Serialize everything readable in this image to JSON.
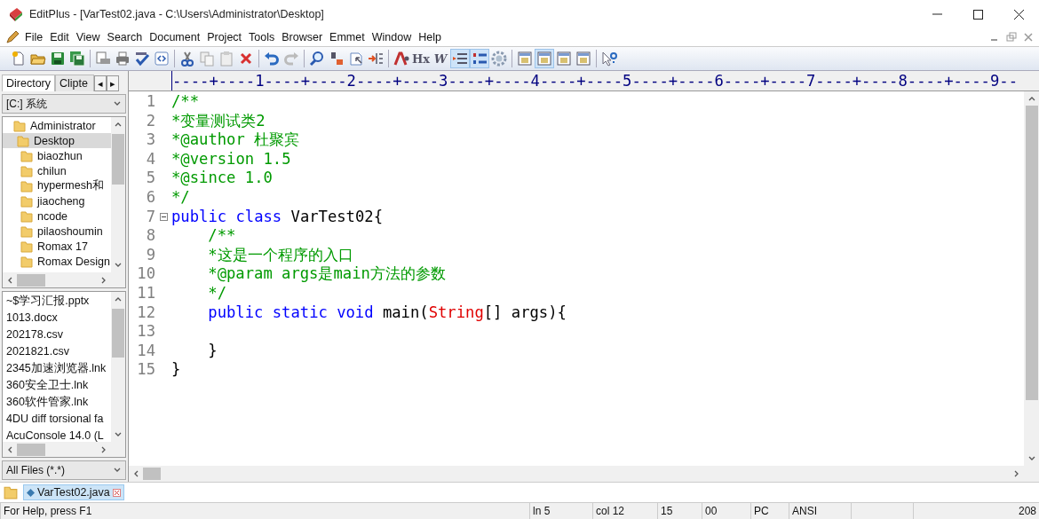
{
  "window": {
    "title": "EditPlus - [VarTest02.java - C:\\Users\\Administrator\\Desktop]"
  },
  "menu": [
    "File",
    "Edit",
    "View",
    "Search",
    "Document",
    "Project",
    "Tools",
    "Browser",
    "Emmet",
    "Window",
    "Help"
  ],
  "toolbar": [
    {
      "kind": "new",
      "on": false
    },
    {
      "kind": "open",
      "on": false
    },
    {
      "kind": "save",
      "on": false
    },
    {
      "kind": "saveall",
      "on": false
    },
    {
      "kind": "sep"
    },
    {
      "kind": "preview",
      "on": false
    },
    {
      "kind": "print",
      "on": false
    },
    {
      "kind": "spell",
      "on": false
    },
    {
      "kind": "browser",
      "on": false
    },
    {
      "kind": "sep"
    },
    {
      "kind": "cut",
      "on": false
    },
    {
      "kind": "copy",
      "on": false
    },
    {
      "kind": "paste",
      "on": false
    },
    {
      "kind": "delete",
      "on": false
    },
    {
      "kind": "sep"
    },
    {
      "kind": "undo",
      "on": false
    },
    {
      "kind": "redo",
      "on": false
    },
    {
      "kind": "sep"
    },
    {
      "kind": "find",
      "on": false
    },
    {
      "kind": "replace",
      "on": false
    },
    {
      "kind": "goto",
      "on": false
    },
    {
      "kind": "insert",
      "on": false
    },
    {
      "kind": "sep"
    },
    {
      "kind": "font",
      "on": false
    },
    {
      "kind": "hex",
      "on": false,
      "glyph": "Hx"
    },
    {
      "kind": "wrap",
      "on": false,
      "glyph": "W"
    },
    {
      "kind": "indent",
      "on": true
    },
    {
      "kind": "linenum",
      "on": true
    },
    {
      "kind": "gear",
      "on": false
    },
    {
      "kind": "sep"
    },
    {
      "kind": "panel",
      "on": false
    },
    {
      "kind": "panel",
      "on": true
    },
    {
      "kind": "panel",
      "on": false
    },
    {
      "kind": "panel",
      "on": false
    },
    {
      "kind": "sep"
    },
    {
      "kind": "help",
      "on": false
    }
  ],
  "sidebar": {
    "tabs": [
      {
        "label": "Directory",
        "selected": true
      },
      {
        "label": "Clipte",
        "selected": false
      }
    ],
    "tab_arrows": [
      "◂",
      "▸"
    ],
    "drive": "[C:] 系统",
    "folders": [
      {
        "label": "Administrator",
        "selected": false,
        "children": [
          {
            "label": "Desktop",
            "selected": true,
            "children": [
              {
                "label": "biaozhun",
                "selected": false
              },
              {
                "label": "chilun",
                "selected": false
              },
              {
                "label": "hypermesh和",
                "selected": false
              },
              {
                "label": "jiaocheng",
                "selected": false
              },
              {
                "label": "ncode",
                "selected": false
              },
              {
                "label": "pilaoshoumin",
                "selected": false
              },
              {
                "label": "Romax 17",
                "selected": false
              },
              {
                "label": "Romax Design",
                "selected": false
              }
            ]
          }
        ]
      }
    ],
    "files": [
      "~$学习汇报.pptx",
      "1013.docx",
      "202178.csv",
      "2021821.csv",
      "2345加速浏览器.lnk",
      "360安全卫士.lnk",
      "360软件管家.lnk",
      "4DU diff torsional fa",
      "AcuConsole 14.0 (L"
    ],
    "filter": "All Files (*.*)"
  },
  "editor": {
    "ruler": "----+----1----+----2----+----3----+----4----+----5----+----6----+----7----+----8----+----9--",
    "lines": [
      {
        "number": "1",
        "tokens": [
          {
            "kind": "comment",
            "text": "/**"
          }
        ]
      },
      {
        "number": "2",
        "tokens": [
          {
            "kind": "comment",
            "text": "*变量测试类2"
          }
        ]
      },
      {
        "number": "3",
        "tokens": [
          {
            "kind": "comment",
            "text": "*@author 杜聚宾"
          }
        ]
      },
      {
        "number": "4",
        "tokens": [
          {
            "kind": "comment",
            "text": "*@version 1.5"
          }
        ]
      },
      {
        "number": "5",
        "tokens": [
          {
            "kind": "comment",
            "text": "*@since 1.0"
          }
        ]
      },
      {
        "number": "6",
        "tokens": [
          {
            "kind": "comment",
            "text": "*/"
          }
        ]
      },
      {
        "number": "7",
        "fold": true,
        "tokens": [
          {
            "kind": "keyword",
            "text": "public "
          },
          {
            "kind": "keyword",
            "text": "class "
          },
          {
            "kind": "plain",
            "text": "VarTest02{"
          }
        ],
        "children": [
          {
            "number": "8",
            "tokens": [
              {
                "kind": "comment",
                "text": "/**"
              }
            ]
          },
          {
            "number": "9",
            "tokens": [
              {
                "kind": "comment",
                "text": "*这是一个程序的入口"
              }
            ]
          },
          {
            "number": "10",
            "tokens": [
              {
                "kind": "comment",
                "text": "*@param args是main方法的参数"
              }
            ]
          },
          {
            "number": "11",
            "tokens": [
              {
                "kind": "comment",
                "text": "*/"
              }
            ]
          },
          {
            "number": "12",
            "tokens": [
              {
                "kind": "keyword",
                "text": "public "
              },
              {
                "kind": "keyword",
                "text": "static "
              },
              {
                "kind": "keyword",
                "text": "void "
              },
              {
                "kind": "plain",
                "text": "main("
              },
              {
                "kind": "type",
                "text": "String"
              },
              {
                "kind": "plain",
                "text": "[] args){"
              }
            ]
          },
          {
            "number": "13"
          },
          {
            "number": "14",
            "tokens": [
              {
                "kind": "plain",
                "text": "}"
              }
            ]
          }
        ]
      },
      {
        "number": "15",
        "tokens": [
          {
            "kind": "plain",
            "text": "}"
          }
        ]
      }
    ]
  },
  "doc_tabs": [
    {
      "label": "VarTest02.java",
      "selected": true
    }
  ],
  "status_bar": [
    "For Help, press F1",
    "ln 5",
    "col 12",
    "15",
    "00",
    "PC",
    "ANSI",
    "208"
  ]
}
